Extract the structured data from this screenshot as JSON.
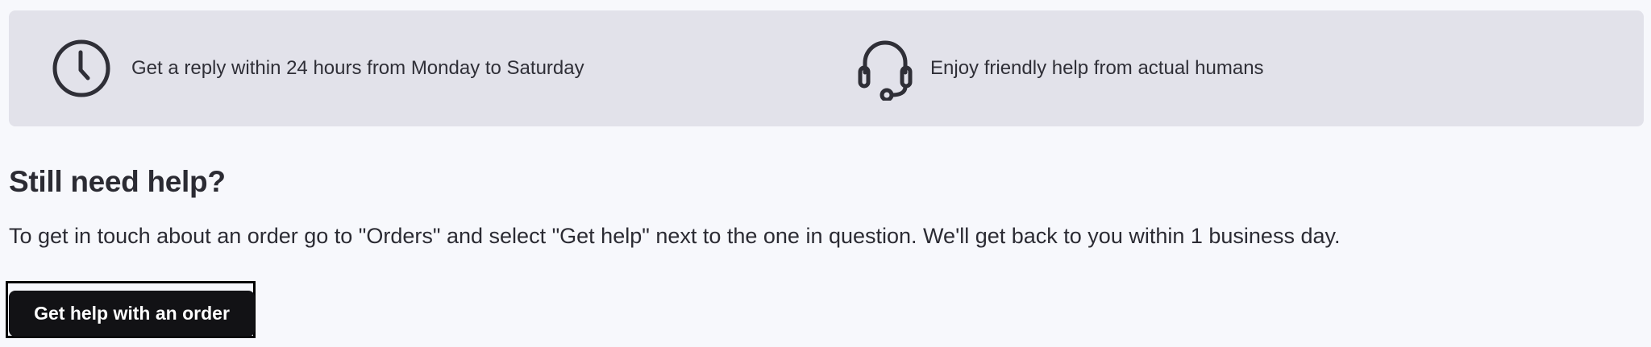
{
  "banner": {
    "items": [
      {
        "icon": "clock-icon",
        "text": "Get a reply within 24 hours from Monday to Saturday"
      },
      {
        "icon": "headset-icon",
        "text": "Enjoy friendly help from actual humans"
      }
    ]
  },
  "help": {
    "heading": "Still need help?",
    "body": "To get in touch about an order go to \"Orders\" and select \"Get help\" next to the one in question. We'll get back to you within 1 business day.",
    "button_label": "Get help with an order"
  },
  "colors": {
    "page_background": "#f7f8fc",
    "banner_background": "#e2e2ea",
    "text": "#2b2b33",
    "button_background": "#121215",
    "button_text": "#ffffff"
  }
}
